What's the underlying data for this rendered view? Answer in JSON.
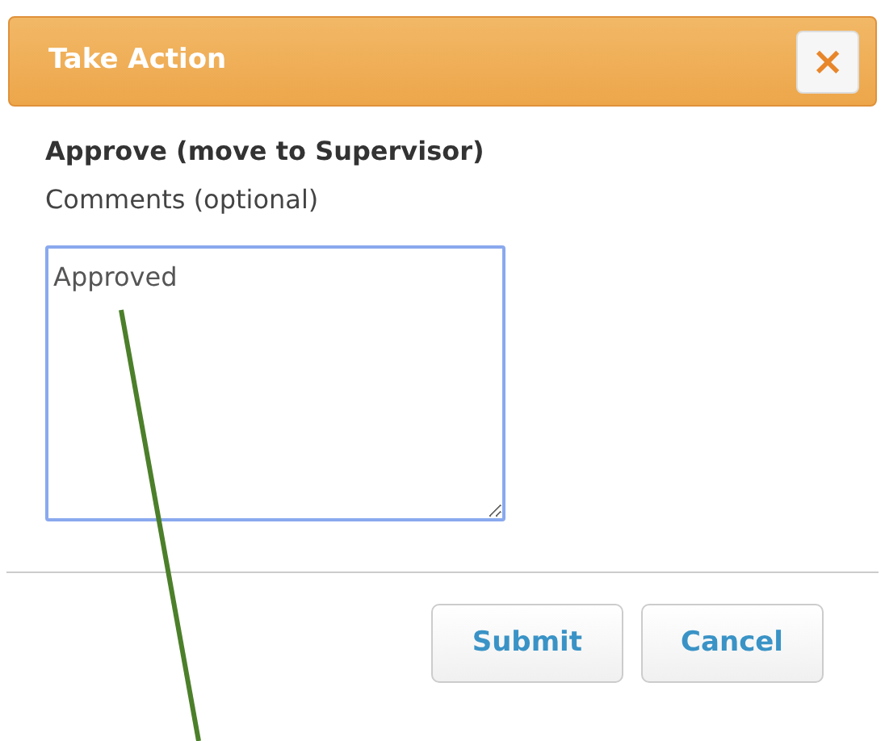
{
  "dialog": {
    "title": "Take Action",
    "close": "×"
  },
  "action": "Approve (move to Supervisor)",
  "comments": {
    "label": "Comments (optional)",
    "value": "Approved"
  },
  "buttons": [
    "Submit",
    "Cancel"
  ]
}
